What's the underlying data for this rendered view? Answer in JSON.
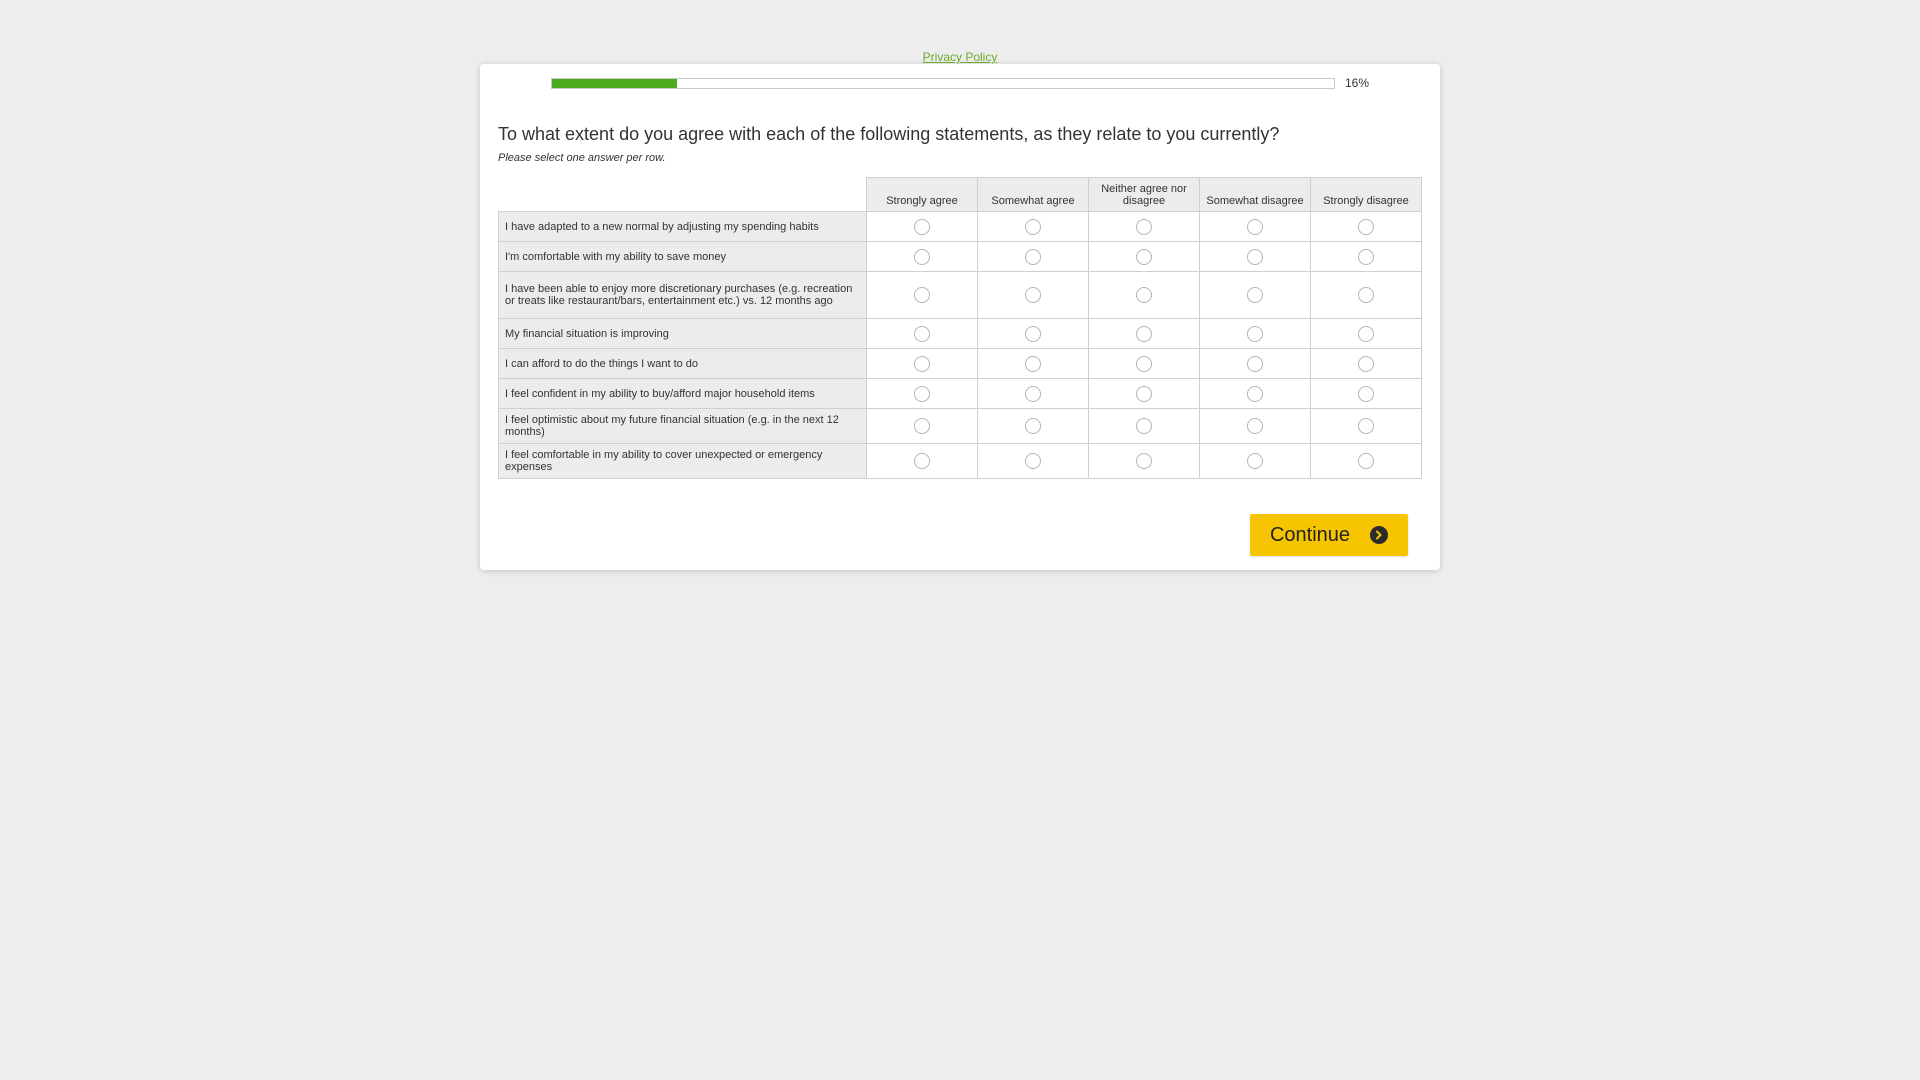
{
  "privacy_link": "Privacy Policy",
  "progress": {
    "percent_label": "16%",
    "fraction": 0.16,
    "fill_color": "#4caa1e"
  },
  "question": "To what extent do you agree with each of the following statements, as they relate to you currently?",
  "instruction": "Please select one answer per row.",
  "columns": [
    "Strongly agree",
    "Somewhat agree",
    "Neither agree nor disagree",
    "Somewhat disagree",
    "Strongly disagree"
  ],
  "rows": [
    "I have adapted to a new normal by adjusting my spending habits",
    "I'm comfortable with my ability to save money",
    "I have been able to enjoy more discretionary purchases (e.g. recreation or treats like restaurant/bars, entertainment etc.) vs. 12 months ago",
    "My financial situation is improving",
    "I can afford to do the things I want to do",
    "I feel confident in my ability to buy/afford major household items",
    "I feel optimistic about my future financial situation (e.g. in the next 12 months)",
    "I feel comfortable in my ability to cover unexpected or emergency expenses"
  ],
  "continue_label": "Continue",
  "continue_icon": "arrow-right-circle-icon",
  "continue_color": "#f7c500"
}
